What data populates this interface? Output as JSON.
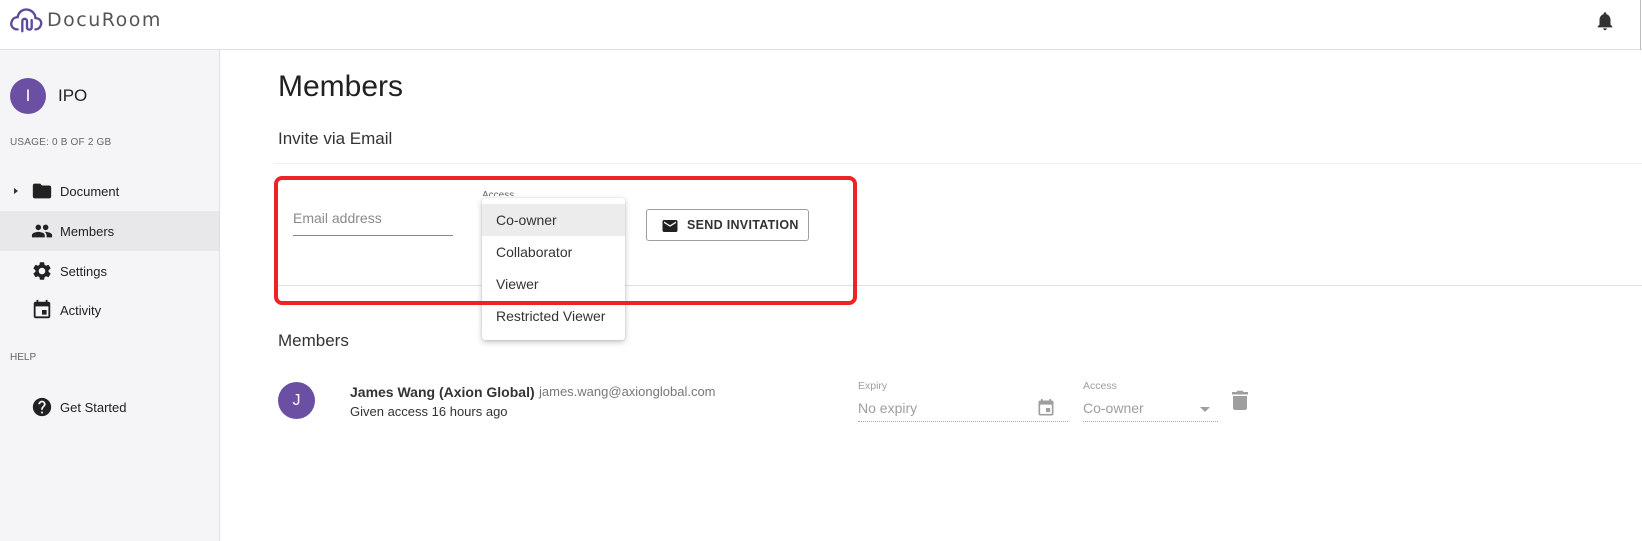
{
  "app": {
    "name": "DocuRoom"
  },
  "sidebar": {
    "workspace": {
      "initial": "I",
      "name": "IPO"
    },
    "usage": "USAGE: 0 B OF 2 GB",
    "items": [
      {
        "label": "Document",
        "icon": "folder-icon",
        "expandable": true
      },
      {
        "label": "Members",
        "icon": "people-icon",
        "active": true
      },
      {
        "label": "Settings",
        "icon": "gear-icon"
      },
      {
        "label": "Activity",
        "icon": "calendar-icon"
      }
    ],
    "help_heading": "HELP",
    "help_items": [
      {
        "label": "Get Started",
        "icon": "help-circle-icon"
      }
    ]
  },
  "main": {
    "title": "Members",
    "invite": {
      "heading": "Invite via Email",
      "email_placeholder": "Email address",
      "access_label": "Access",
      "send_label": "SEND INVITATION",
      "access_options": [
        "Co-owner",
        "Collaborator",
        "Viewer",
        "Restricted Viewer"
      ],
      "selected_option": "Co-owner"
    },
    "members_heading": "Members",
    "members": [
      {
        "initial": "J",
        "name": "James Wang (Axion Global)",
        "email": "james.wang@axionglobal.com",
        "given": "Given access 16 hours ago",
        "expiry_label": "Expiry",
        "expiry": "No expiry",
        "access_label": "Access",
        "access": "Co-owner"
      }
    ]
  },
  "colors": {
    "avatar": "#6a4fa3",
    "highlight": "#ee2323",
    "sidebar_bg": "#f5f5f7"
  }
}
